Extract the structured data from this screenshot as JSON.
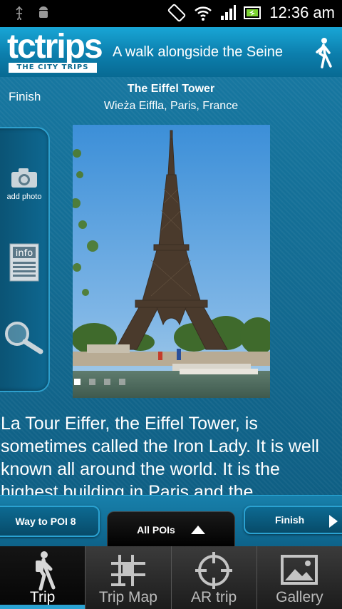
{
  "status_bar": {
    "time": "12:36 am",
    "icons": [
      "usb-icon",
      "android-debug-icon",
      "rotation-icon",
      "wifi-icon",
      "signal-icon",
      "battery-icon"
    ]
  },
  "header": {
    "logo_word": "tctrips",
    "logo_sub": "THE CITY TRIPS",
    "tagline": "A walk alongside the Seine",
    "icon": "walking-person-icon"
  },
  "poi": {
    "finish_label": "Finish",
    "title": "The Eiffel Tower",
    "subtitle": "Wieża Eiffla, Paris, France",
    "photo_dots": {
      "total": 4,
      "active": 0
    },
    "description": "La Tour Eiffer, the Eiffel Tower, is sometimes called the Iron Lady. It is well known all around the world. It is the highest building in Paris and the"
  },
  "side_panel": {
    "add_photo_label": "add photo",
    "info_label": "info"
  },
  "nav": {
    "prev_label": "Way to POI 8",
    "all_pois_label": "All POIs",
    "next_label": "Finish"
  },
  "tabs": [
    {
      "label": "Trip",
      "icon": "hiker-icon",
      "active": true
    },
    {
      "label": "Trip Map",
      "icon": "map-icon",
      "active": false
    },
    {
      "label": "AR trip",
      "icon": "crosshair-icon",
      "active": false
    },
    {
      "label": "Gallery",
      "icon": "gallery-icon",
      "active": false
    }
  ],
  "colors": {
    "accent": "#2aa2d2",
    "header_top": "#18a6d6",
    "background": "#0f5b7c"
  }
}
